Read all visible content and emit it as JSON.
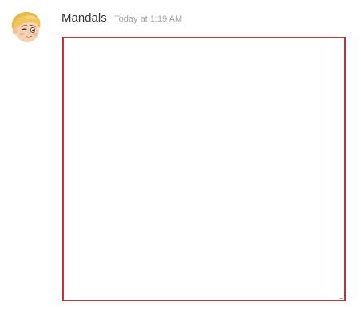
{
  "message": {
    "author": "Mandals",
    "timestamp": "Today at 1:19 AM",
    "avatar_icon": "cartoon-blond-avatar-icon",
    "attachment_border_color": "#c8323a"
  }
}
